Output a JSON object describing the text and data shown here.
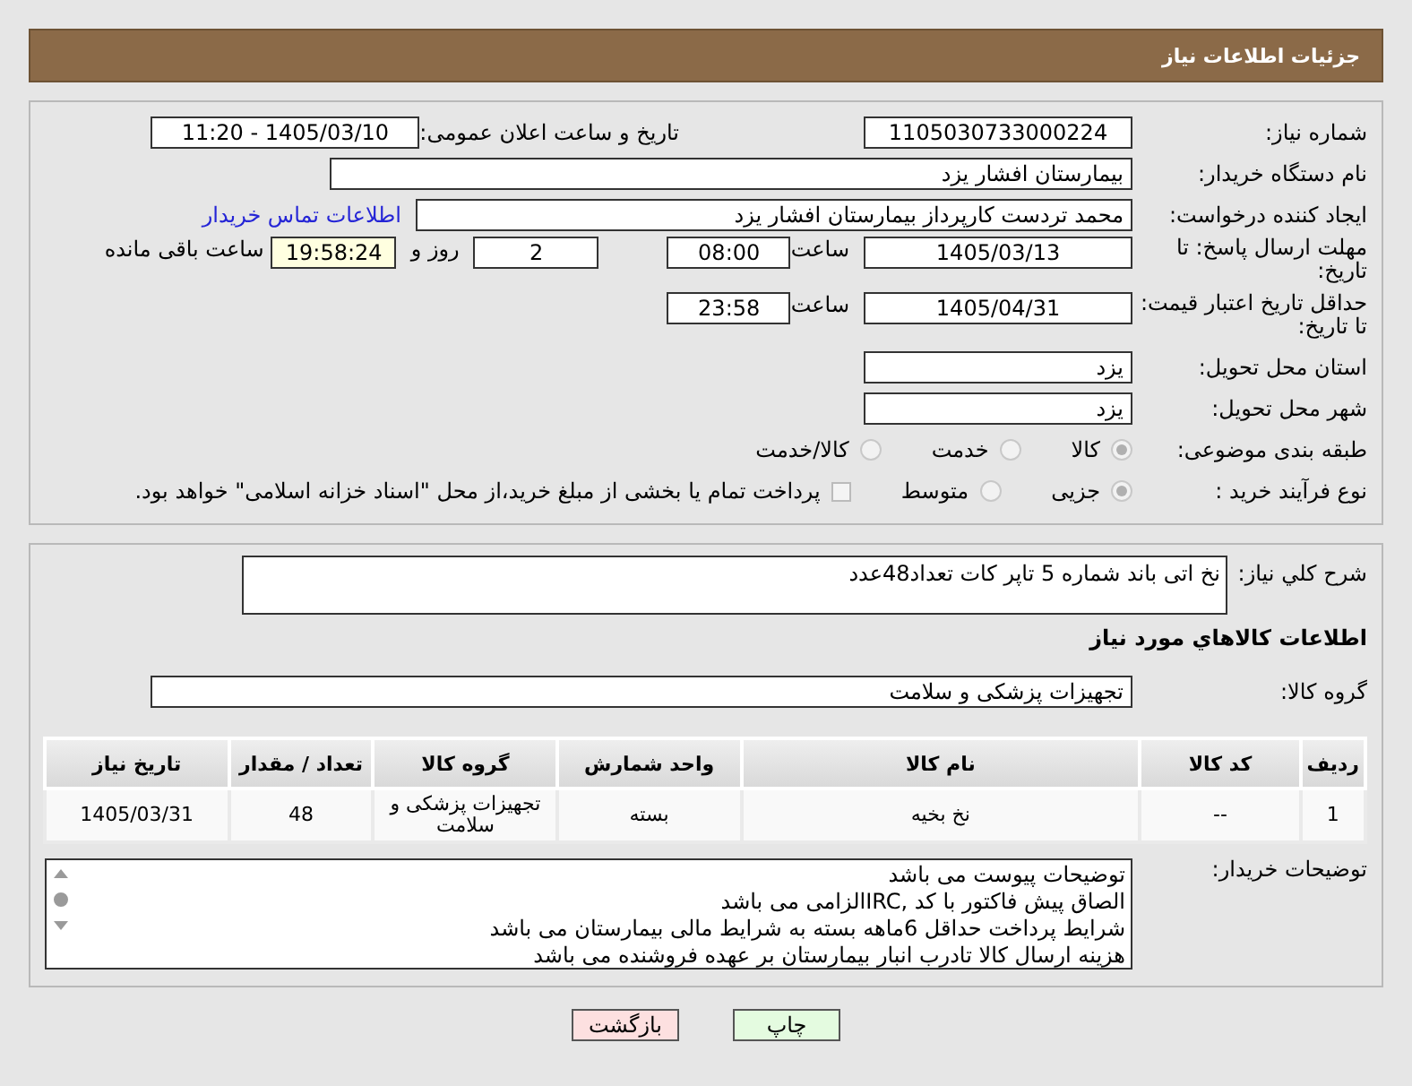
{
  "header": {
    "title": "جزئیات اطلاعات نیاز"
  },
  "need_number": {
    "label": "شماره نیاز:",
    "value": "1105030733000224"
  },
  "announce": {
    "label": "تاریخ و ساعت اعلان عمومی:",
    "value": "1405/03/10 - 11:20"
  },
  "buyer": {
    "label": "نام دستگاه خریدار:",
    "value": "بیمارستان افشار یزد"
  },
  "requester": {
    "label": "ایجاد کننده درخواست:",
    "value": "محمد تردست کارپرداز بیمارستان افشار یزد",
    "link": "اطلاعات تماس خریدار"
  },
  "deadline": {
    "label": "مهلت ارسال پاسخ: تا تاریخ:",
    "date": "1405/03/13",
    "time_label": "ساعت",
    "time": "08:00",
    "days": "2",
    "days_label": "روز و",
    "remaining": "19:58:24",
    "remaining_label": "ساعت باقی مانده"
  },
  "validity": {
    "label": "حداقل تاریخ اعتبار قیمت: تا تاریخ:",
    "date": "1405/04/31",
    "time_label": "ساعت",
    "time": "23:58"
  },
  "province": {
    "label": "استان محل تحویل:",
    "value": "یزد"
  },
  "city": {
    "label": "شهر محل تحویل:",
    "value": "یزد"
  },
  "category": {
    "label": "طبقه بندی موضوعی:",
    "options": [
      {
        "label": "کالا",
        "selected": true
      },
      {
        "label": "خدمت",
        "selected": false
      },
      {
        "label": "کالا/خدمت",
        "selected": false
      }
    ]
  },
  "purchase_type": {
    "label": "نوع فرآیند خرید :",
    "options": [
      {
        "label": "جزیی",
        "selected": true
      },
      {
        "label": "متوسط",
        "selected": false
      }
    ],
    "payment_note": {
      "label": "پرداخت تمام یا بخشی از مبلغ خرید،از محل \"اسناد خزانه اسلامی\" خواهد بود.",
      "checked": false
    }
  },
  "description": {
    "label": "شرح کلي نياز:",
    "value": "نخ اتی باند  شماره 5 تاپر کات تعداد48عدد"
  },
  "goods_heading": "اطلاعات کالاهاي مورد نياز",
  "goods_group": {
    "label": "گروه کالا:",
    "value": "تجهیزات پزشکی و سلامت"
  },
  "table": {
    "columns": [
      "ردیف",
      "کد کالا",
      "نام کالا",
      "واحد شمارش",
      "گروه کالا",
      "تعداد / مقدار",
      "تاریخ نیاز"
    ],
    "rows": [
      [
        "1",
        "--",
        "نخ بخیه",
        "بسته",
        "تجهیزات پزشکی و سلامت",
        "48",
        "1405/03/31"
      ]
    ]
  },
  "buyer_notes": {
    "label": "توضیحات خریدار:",
    "lines": [
      "توضیحات پیوست می باشد",
      "الصاق پیش فاکتور با کد  ,IRCالزامی می باشد",
      "شرایط پرداخت حداقل 6ماهه بسته به شرایط مالی بیمارستان می باشد",
      "هزینه ارسال کالا تادرب انبار بیمارستان بر عهده فروشنده می باشد"
    ]
  },
  "buttons": [
    {
      "kind": "print",
      "label": "چاپ"
    },
    {
      "kind": "back",
      "label": "بازگشت"
    }
  ]
}
